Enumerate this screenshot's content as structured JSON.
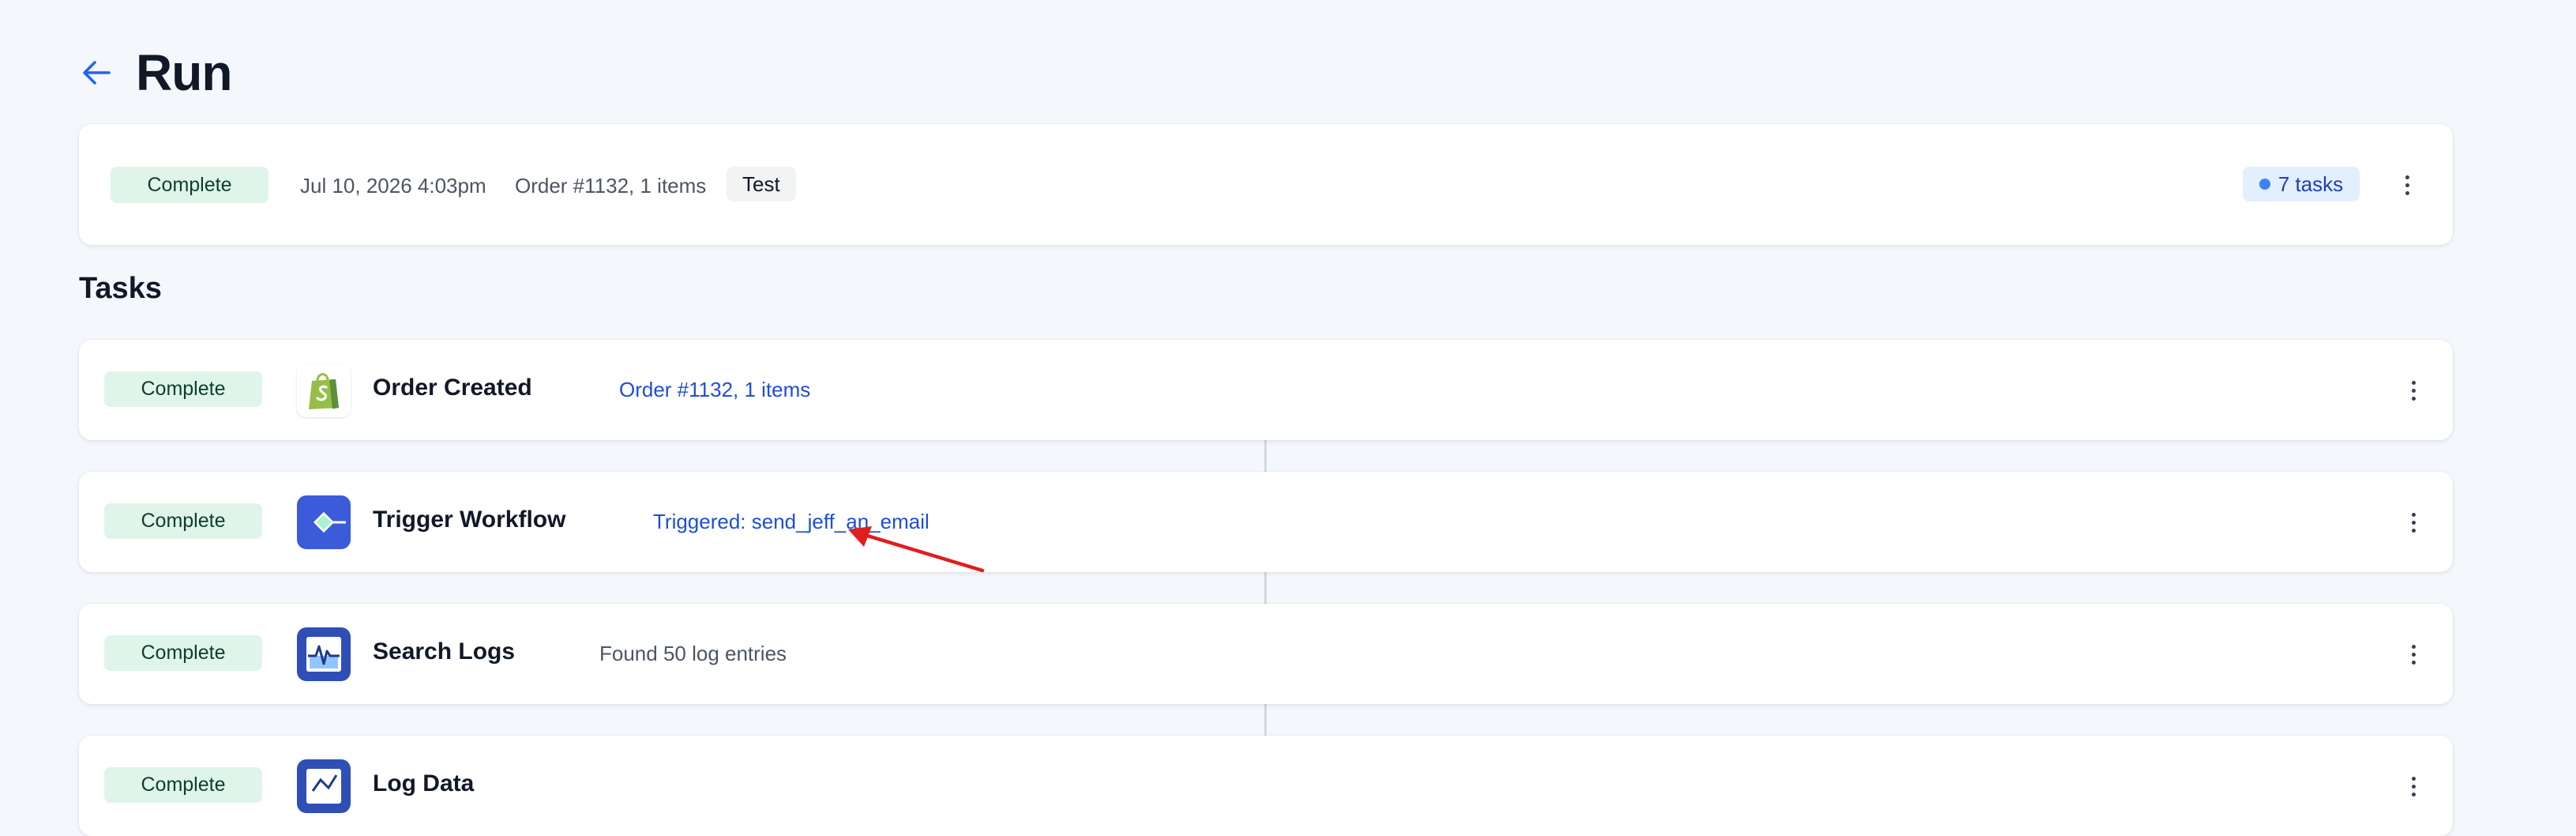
{
  "header": {
    "title": "Run",
    "back_icon": "arrow-left-icon"
  },
  "run": {
    "status": "Complete",
    "date": "Jul 10, 2026 4:03pm",
    "order": "Order #1132, 1 items",
    "tag": "Test",
    "tasks_count": "7 tasks"
  },
  "tasks_section": {
    "title": "Tasks"
  },
  "tasks": [
    {
      "status": "Complete",
      "title": "Order Created",
      "detail": "Order #1132, 1 items",
      "icon": "shopify-bag-icon"
    },
    {
      "status": "Complete",
      "title": "Trigger Workflow",
      "detail": "Triggered: send_jeff_an_email",
      "icon": "workflow-trigger-icon"
    },
    {
      "status": "Complete",
      "title": "Search Logs",
      "detail": "Found 50 log entries",
      "icon": "log-activity-icon"
    },
    {
      "status": "Complete",
      "title": "Log Data",
      "detail": "",
      "icon": "log-data-icon"
    }
  ],
  "colors": {
    "background": "#f4f7fb",
    "complete_badge": "#dff5ea",
    "link": "#1d4ed8",
    "annotation_arrow": "#e11d1d",
    "shopify_green": "#95bf47",
    "workflow_blue": "#3b5bdb"
  }
}
